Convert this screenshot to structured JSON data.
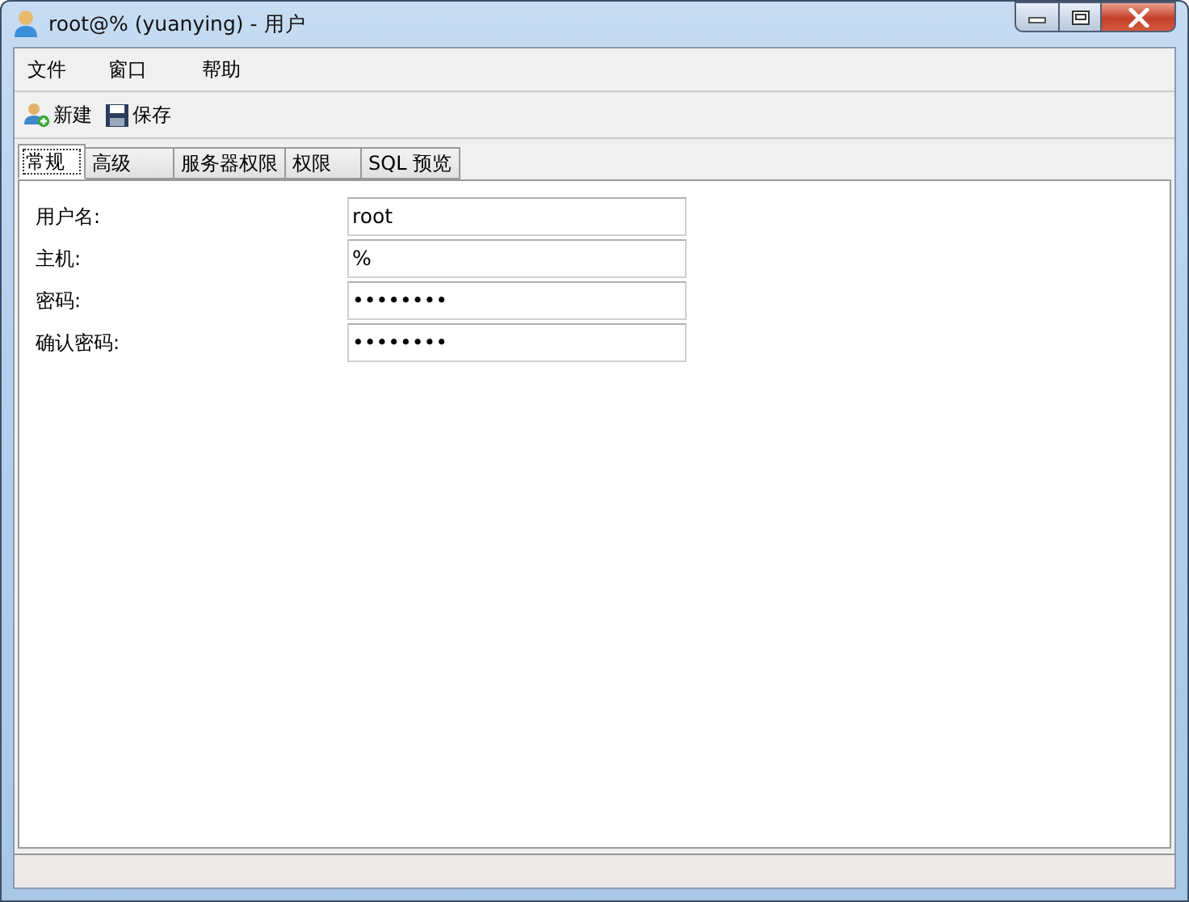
{
  "window": {
    "title": "root@% (yuanying) - 用户"
  },
  "menu": [
    {
      "label": "文件"
    },
    {
      "label": "窗口"
    },
    {
      "label": "帮助"
    }
  ],
  "toolbar": [
    {
      "label": "新建",
      "kind": "new-user"
    },
    {
      "label": "保存",
      "kind": "save"
    }
  ],
  "tabs": [
    {
      "label": "常规",
      "selected": true
    },
    {
      "label": "高级",
      "selected": false
    },
    {
      "label": "服务器权限",
      "selected": false
    },
    {
      "label": "权限",
      "selected": false
    },
    {
      "label": "SQL 预览",
      "selected": false
    }
  ],
  "fields": [
    {
      "label": "用户名:",
      "value": "root"
    },
    {
      "label": "主机:",
      "value": "%"
    },
    {
      "label": "密码:",
      "value": "••••••••"
    },
    {
      "label": "确认密码:",
      "value": "••••••••"
    }
  ]
}
